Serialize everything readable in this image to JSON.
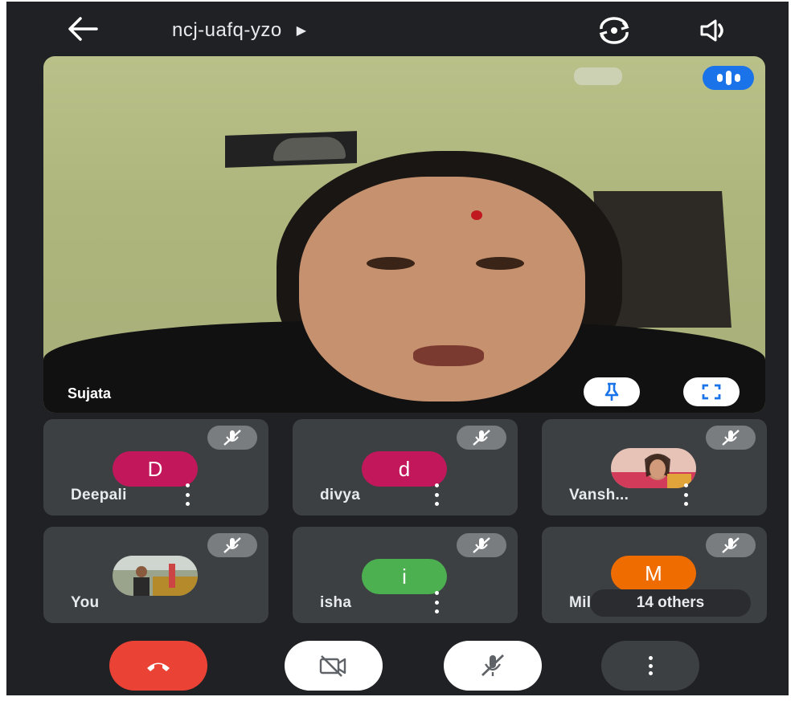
{
  "header": {
    "meeting_code": "ncj-uafq-yzo",
    "back_icon": "arrow-left-icon",
    "switch_camera_icon": "switch-camera-icon",
    "speaker_icon": "speaker-icon"
  },
  "main_video": {
    "participant_name": "Sujata",
    "audio_indicator_icon": "audio-level-icon",
    "pin_icon": "pin-icon",
    "fullscreen_icon": "fullscreen-icon"
  },
  "tiles": [
    {
      "name": "Deepali",
      "initial": "D",
      "avatar_color": "#c2185b",
      "muted": true
    },
    {
      "name": "divya",
      "initial": "d",
      "avatar_color": "#c2185b",
      "muted": true
    },
    {
      "name": "Vansh...",
      "initial": "",
      "avatar_color": "",
      "muted": true
    },
    {
      "name": "You",
      "initial": "",
      "avatar_color": "",
      "muted": true
    },
    {
      "name": "isha",
      "initial": "i",
      "avatar_color": "#4caf50",
      "muted": true
    },
    {
      "name": "Mil",
      "initial": "M",
      "avatar_color": "#ef6c00",
      "muted": true,
      "others_label": "14 others"
    }
  ],
  "controls": {
    "end_call_icon": "end-call-icon",
    "camera_off_icon": "camera-off-icon",
    "mic_off_icon": "mic-off-icon",
    "more_icon": "more-vert-icon",
    "end_call_color": "#ea4335"
  }
}
